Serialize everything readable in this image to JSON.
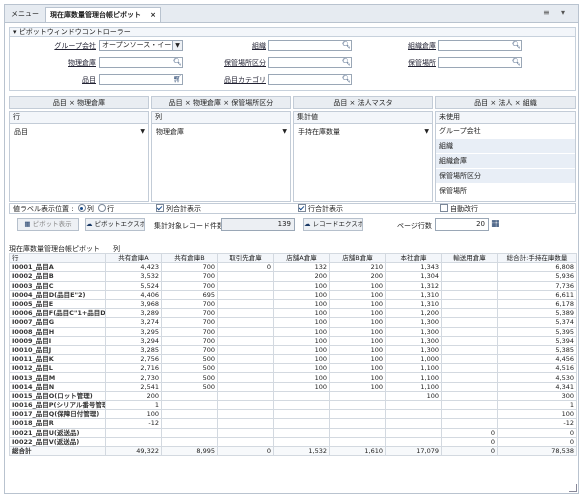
{
  "tabs": [
    {
      "label": "メニュー"
    },
    {
      "label": "現在庫数量管理台帳ピボット",
      "close": "×"
    }
  ],
  "window_controls": {
    "menu": "≡",
    "dropdown": "▾"
  },
  "controller": {
    "title": "▾ ピボットウィンドウコントローラー"
  },
  "filters": {
    "group_company": {
      "label": "グループ会社",
      "value": "オープンソース・イー"
    },
    "org": {
      "label": "組織",
      "value": ""
    },
    "org_warehouse": {
      "label": "組織倉庫",
      "value": ""
    },
    "physical_warehouse": {
      "label": "物理倉庫",
      "value": ""
    },
    "storage_category": {
      "label": "保管場所区分",
      "value": ""
    },
    "storage_place": {
      "label": "保管場所",
      "value": ""
    },
    "item": {
      "label": "品目",
      "value": ""
    },
    "item_category": {
      "label": "品目カテゴリ",
      "value": ""
    }
  },
  "presets": [
    "品目 × 物理倉庫",
    "品目 × 物理倉庫 × 保管場所区分",
    "品目 × 法人マスタ",
    "品目 × 法人 × 組織"
  ],
  "zones": {
    "row": {
      "header": "行",
      "value": "品目"
    },
    "col": {
      "header": "列",
      "value": "物理倉庫"
    },
    "agg": {
      "header": "集計値",
      "value": "手持在庫数量"
    },
    "unused": {
      "header": "未使用",
      "items": [
        "グループ会社",
        "組織",
        "組織倉庫",
        "保管場所区分",
        "保管場所"
      ]
    }
  },
  "options": {
    "label_position": "値ラベル表示位置 :",
    "label_col": "列",
    "label_row": "行",
    "col_total": "列合計表示",
    "row_total": "行合計表示",
    "auto_wrap": "自動改行"
  },
  "toolbar": {
    "pivot_show": "ピボット表示",
    "pivot_export": "ピボットエクスポ-",
    "record_count_label": "集計対象レコード件数",
    "record_count": "139",
    "record_export": "レコードエクスポ-",
    "page_rows_label": "ページ行数",
    "page_rows": "20"
  },
  "pivot": {
    "caption": "現在庫数量管理台帳ピボット",
    "col_caption": "列",
    "row_caption": "行",
    "headers": [
      "共有倉庫A",
      "共有倉庫B",
      "取引先倉庫",
      "店舗A倉庫",
      "店舗B倉庫",
      "本社倉庫",
      "輸送用倉庫",
      "総合計:手持在庫数量"
    ],
    "rows": [
      {
        "name": "I0001_品目A",
        "cells": [
          "4,423",
          "700",
          "0",
          "132",
          "210",
          "1,343",
          "",
          "6,808"
        ]
      },
      {
        "name": "I0002_品目B",
        "cells": [
          "3,532",
          "700",
          "",
          "200",
          "200",
          "1,304",
          "",
          "5,936"
        ]
      },
      {
        "name": "I0003_品目C",
        "cells": [
          "5,524",
          "700",
          "",
          "100",
          "100",
          "1,312",
          "",
          "7,736"
        ]
      },
      {
        "name": "I0004_品目D(品目E\"2)",
        "cells": [
          "4,406",
          "695",
          "",
          "100",
          "100",
          "1,310",
          "",
          "6,611"
        ]
      },
      {
        "name": "I0005_品目E",
        "cells": [
          "3,968",
          "700",
          "",
          "100",
          "100",
          "1,310",
          "",
          "6,178"
        ]
      },
      {
        "name": "I0006_品目F(品目C\"1+品目D\"1)",
        "cells": [
          "3,289",
          "700",
          "",
          "100",
          "100",
          "1,200",
          "",
          "5,389"
        ]
      },
      {
        "name": "I0007_品目G",
        "cells": [
          "3,274",
          "700",
          "",
          "100",
          "100",
          "1,300",
          "",
          "5,374"
        ]
      },
      {
        "name": "I0008_品目H",
        "cells": [
          "3,295",
          "700",
          "",
          "100",
          "100",
          "1,300",
          "",
          "5,395"
        ]
      },
      {
        "name": "I0009_品目I",
        "cells": [
          "3,294",
          "700",
          "",
          "100",
          "100",
          "1,300",
          "",
          "5,394"
        ]
      },
      {
        "name": "I0010_品目J",
        "cells": [
          "3,285",
          "700",
          "",
          "100",
          "100",
          "1,300",
          "",
          "5,385"
        ]
      },
      {
        "name": "I0011_品目K",
        "cells": [
          "2,756",
          "500",
          "",
          "100",
          "100",
          "1,000",
          "",
          "4,456"
        ]
      },
      {
        "name": "I0012_品目L",
        "cells": [
          "2,716",
          "500",
          "",
          "100",
          "100",
          "1,100",
          "",
          "4,516"
        ]
      },
      {
        "name": "I0013_品目M",
        "cells": [
          "2,730",
          "500",
          "",
          "100",
          "100",
          "1,100",
          "",
          "4,530"
        ]
      },
      {
        "name": "I0014_品目N",
        "cells": [
          "2,541",
          "500",
          "",
          "100",
          "100",
          "1,100",
          "",
          "4,341"
        ]
      },
      {
        "name": "I0015_品目O(ロット管理)",
        "cells": [
          "200",
          "",
          "",
          "",
          "",
          "100",
          "",
          "300"
        ]
      },
      {
        "name": "I0016_品目P(シリアル番号管理)",
        "cells": [
          "1",
          "",
          "",
          "",
          "",
          "",
          "",
          "1"
        ]
      },
      {
        "name": "I0017_品目Q(保障日付管理)",
        "cells": [
          "100",
          "",
          "",
          "",
          "",
          "",
          "",
          "100"
        ]
      },
      {
        "name": "I0018_品目R",
        "cells": [
          "-12",
          "",
          "",
          "",
          "",
          "",
          "",
          "-12"
        ]
      },
      {
        "name": "I0021_品目U(返送品)",
        "cells": [
          "",
          "",
          "",
          "",
          "",
          "",
          "0",
          "0"
        ]
      },
      {
        "name": "I0022_品目V(返送品)",
        "cells": [
          "",
          "",
          "",
          "",
          "",
          "",
          "0",
          "0"
        ]
      }
    ],
    "total": {
      "name": "総合計",
      "cells": [
        "49,322",
        "8,995",
        "0",
        "1,532",
        "1,610",
        "17,079",
        "0",
        "78,538"
      ]
    }
  }
}
